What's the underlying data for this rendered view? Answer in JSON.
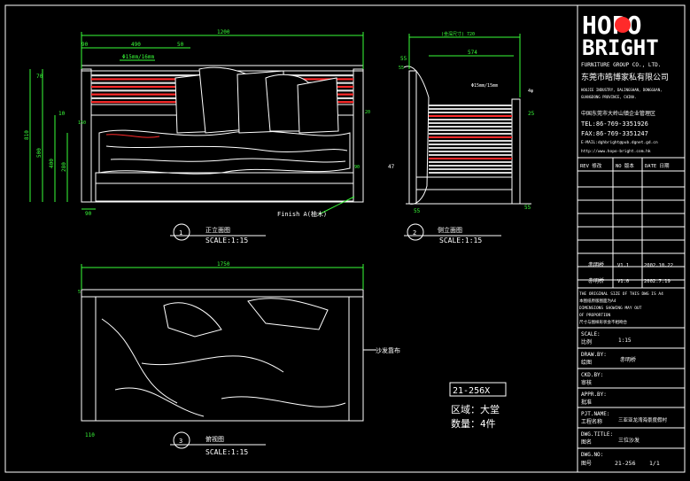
{
  "colors": {
    "bg": "#000000",
    "line": "#ffffff",
    "dim": "#39ff39",
    "accent": "#ff2a2a",
    "gray": "#9a9a9a",
    "slat": "#d8d8d8"
  },
  "logo": {
    "top": "HOPO",
    "bottom": "BRIGHT"
  },
  "company": {
    "en": "FURNITURE GROUP CO., LTD.",
    "cn": "东莞市皓博家私有限公司",
    "addr1": "HOUJIE INDUSTRY, DALINGSHAN, DONGGUAN,",
    "addr2": "GUANGDONG PROVINCE, CHINA.",
    "addr3": "中国东莞市大岭山镇企业管理区",
    "tel": "TEL:86-769-3351926",
    "fax": "FAX:86-769-3351247",
    "email": "E-MAIL:dghbright@pub.dgnet.gd.cn",
    "web": "http://www.hopo-bright.com.hk"
  },
  "revision": {
    "headers": [
      "REV 修改",
      "NO 版本",
      "DATE 日期"
    ],
    "rows": [
      {
        "by": "赤明桥",
        "no": "V1.1",
        "date": "2002.10.22"
      },
      {
        "by": "赤明桥",
        "no": "V1.0",
        "date": "2002.7.19"
      }
    ]
  },
  "notes": [
    "THE ORIGINAL SIZE OF THIS DWG IS A4",
    "本图纸原版图面为A4",
    "DIMENSIONS SHOWING MAY OUT",
    "OF PROPORTION",
    "尺寸与图样形状会不相吻合"
  ],
  "info": {
    "scale_label": "SCALE:",
    "scale_cn": "比例",
    "scale_value": "1:15",
    "drawn_label": "DRAW.BY:",
    "drawn_cn": "绘图",
    "drawn_value": "赤明桥",
    "chk_label": "CKD.BY:",
    "chk_cn": "审核",
    "appr_label": "APPR.BY:",
    "appr_cn": "批准",
    "proj_label": "PJT.NAME:",
    "proj_cn": "工程名称",
    "proj_value": "三亚亚龙湾海景度假村",
    "title_label": "DWG.TITLE:",
    "title_cn": "图名",
    "title_value": "三位沙发",
    "no_label": "DWG.NO:",
    "no_cn": "图号",
    "no_value": "21-256",
    "sheet_value": "1/1"
  },
  "views": {
    "front": {
      "num": "1",
      "title": "正立面图",
      "scale": "SCALE:1:15"
    },
    "side": {
      "num": "2",
      "title": "侧立面图",
      "scale": "SCALE:1:15"
    },
    "top": {
      "num": "3",
      "title": "俯视图",
      "scale": "SCALE:1:15"
    }
  },
  "callouts": {
    "finish": "Finish A(柚木)",
    "cloth": "沙发靠布",
    "slat_front": "Φ15mm/16mm",
    "slat_side": "Φ15mm/15mm",
    "hatch": "4φ"
  },
  "tag": {
    "code": "21-256X",
    "area": "区域：大堂",
    "qty": "数量：4件"
  },
  "dims": {
    "front_total": "1200",
    "f_90": "90",
    "f_490": "490",
    "f_50": "50",
    "f_70": "70",
    "f_10": "10",
    "f_810": "810",
    "f_500": "500",
    "f_400": "400",
    "f_280": "280",
    "f_150": "150",
    "f_20": "20",
    "f_90b": "90",
    "f_90c": "90",
    "side_total": "(坐深尺寸) 720",
    "s_55": "55",
    "s_574": "574",
    "s_25": "25",
    "s_47": "47",
    "s_55b": "55",
    "s_55c": "55",
    "s_55d": "55",
    "top_total": "1750",
    "t_5": "5",
    "t_110": "110"
  }
}
